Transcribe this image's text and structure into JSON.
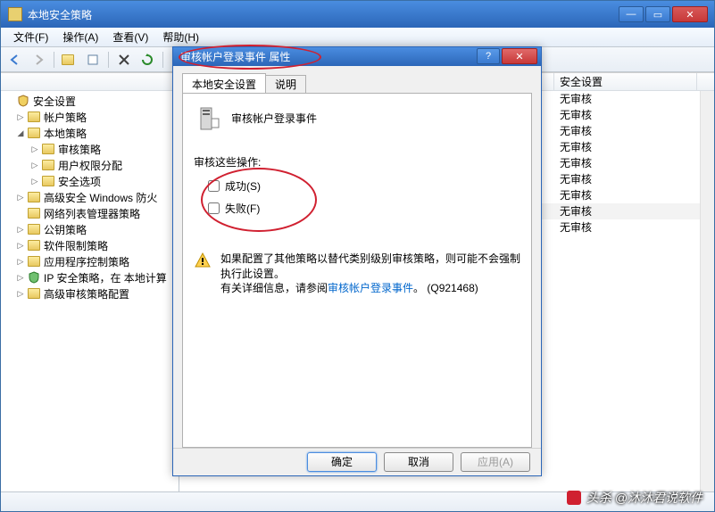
{
  "window": {
    "title": "本地安全策略"
  },
  "menu": {
    "file": "文件(F)",
    "action": "操作(A)",
    "view": "查看(V)",
    "help": "帮助(H)"
  },
  "tree": {
    "header": "",
    "root": "安全设置",
    "items": [
      {
        "label": "帐户策略",
        "indent": 1,
        "exp": "▷"
      },
      {
        "label": "本地策略",
        "indent": 1,
        "exp": "◢"
      },
      {
        "label": "审核策略",
        "indent": 2,
        "exp": "▷"
      },
      {
        "label": "用户权限分配",
        "indent": 2,
        "exp": "▷"
      },
      {
        "label": "安全选项",
        "indent": 2,
        "exp": "▷"
      },
      {
        "label": "高级安全 Windows 防火",
        "indent": 1,
        "exp": "▷"
      },
      {
        "label": "网络列表管理器策略",
        "indent": 1,
        "exp": ""
      },
      {
        "label": "公钥策略",
        "indent": 1,
        "exp": "▷"
      },
      {
        "label": "软件限制策略",
        "indent": 1,
        "exp": "▷"
      },
      {
        "label": "应用程序控制策略",
        "indent": 1,
        "exp": "▷"
      },
      {
        "label": "IP 安全策略，在 本地计算",
        "indent": 1,
        "exp": "▷",
        "shield": true
      },
      {
        "label": "高级审核策略配置",
        "indent": 1,
        "exp": "▷"
      }
    ]
  },
  "list": {
    "col_setting": "安全设置",
    "rows": [
      {
        "setting": "无审核"
      },
      {
        "setting": "无审核"
      },
      {
        "setting": "无审核"
      },
      {
        "setting": "无审核"
      },
      {
        "setting": "无审核"
      },
      {
        "setting": "无审核"
      },
      {
        "setting": "无审核"
      },
      {
        "setting": "无审核",
        "sel": true
      },
      {
        "setting": "无审核"
      }
    ]
  },
  "dialog": {
    "title": "审核帐户登录事件 属性",
    "tab_local": "本地安全设置",
    "tab_explain": "说明",
    "policy_name": "审核帐户登录事件",
    "audit_label": "审核这些操作:",
    "chk_success": "成功(S)",
    "chk_failure": "失败(F)",
    "warn_line1": "如果配置了其他策略以替代类别级别审核策略，则可能不会强制执行此设置。",
    "warn_line2_a": "有关详细信息，请参阅",
    "warn_link": "审核帐户登录事件",
    "warn_line2_b": "。  (Q921468)",
    "btn_ok": "确定",
    "btn_cancel": "取消",
    "btn_apply": "应用(A)"
  },
  "watermark": "头杀 @沐沐君说软件"
}
